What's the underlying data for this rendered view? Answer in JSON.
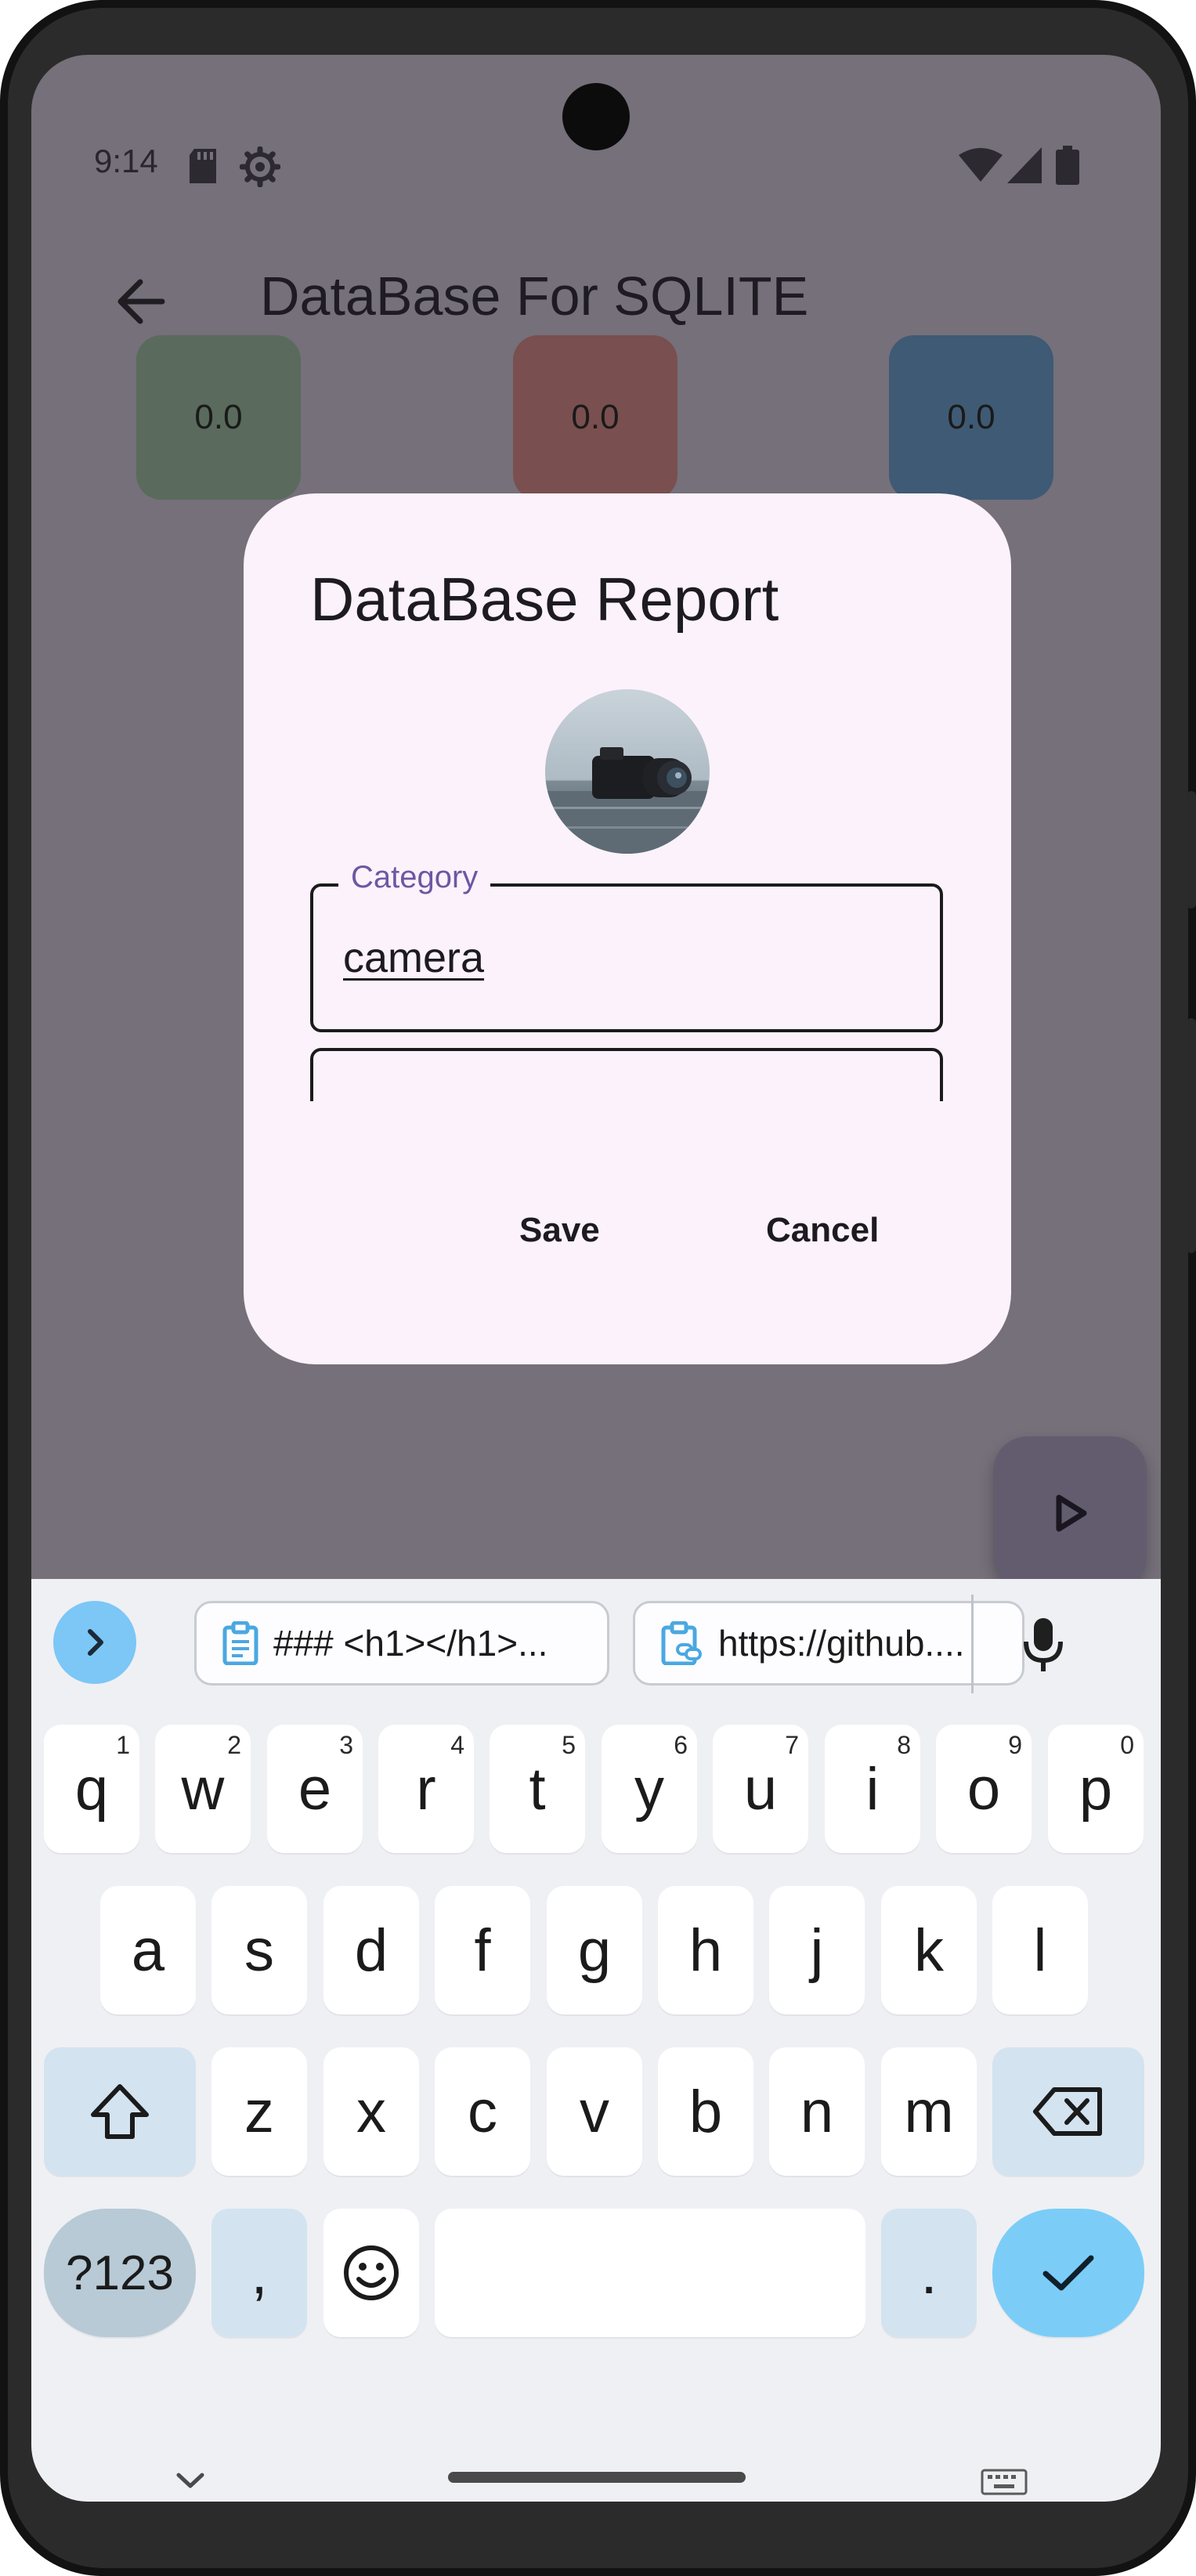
{
  "status_bar": {
    "time": "9:14",
    "left_icons": [
      "sd-card-icon",
      "settings-gear-icon"
    ],
    "right_icons": [
      "wifi-icon",
      "signal-icon",
      "battery-icon"
    ]
  },
  "app_bar": {
    "back_icon": "arrow-back-icon",
    "title": "DataBase For SQLITE"
  },
  "summary_tiles": [
    {
      "value": "0.0",
      "color": "#5a6a5c"
    },
    {
      "value": "0.0",
      "color": "#7a4f4f"
    },
    {
      "value": "0.0",
      "color": "#3f5a74"
    }
  ],
  "fab": {
    "icon": "play-arrow-icon"
  },
  "dialog": {
    "title": "DataBase Report",
    "image": "camera-photo",
    "category_label": "Category",
    "category_value": "camera",
    "save_label": "Save",
    "cancel_label": "Cancel"
  },
  "keyboard": {
    "expand_icon": "chevron-right-icon",
    "clipboard": [
      {
        "icon": "clipboard-icon",
        "text": "### <h1></h1>..."
      },
      {
        "icon": "clipboard-link-icon",
        "text": "https://github...."
      }
    ],
    "mic_icon": "mic-icon",
    "row1": [
      {
        "label": "q",
        "hint": "1"
      },
      {
        "label": "w",
        "hint": "2"
      },
      {
        "label": "e",
        "hint": "3"
      },
      {
        "label": "r",
        "hint": "4"
      },
      {
        "label": "t",
        "hint": "5"
      },
      {
        "label": "y",
        "hint": "6"
      },
      {
        "label": "u",
        "hint": "7"
      },
      {
        "label": "i",
        "hint": "8"
      },
      {
        "label": "o",
        "hint": "9"
      },
      {
        "label": "p",
        "hint": "0"
      }
    ],
    "row2": [
      "a",
      "s",
      "d",
      "f",
      "g",
      "h",
      "j",
      "k",
      "l"
    ],
    "row3": [
      "z",
      "x",
      "c",
      "v",
      "b",
      "n",
      "m"
    ],
    "shift_icon": "shift-icon",
    "backspace_icon": "backspace-icon",
    "symbols_label": "?123",
    "comma_label": ",",
    "emoji_icon": "emoji-icon",
    "period_label": ".",
    "enter_icon": "check-icon",
    "hide_keyboard_icon": "chevron-down-icon",
    "switch_keyboard_icon": "keyboard-icon"
  },
  "colors": {
    "scrim": "#75707a",
    "dialog_bg": "#fcf2fb",
    "accent_label": "#6e56a3",
    "keyboard_bg": "#eff0f4",
    "key_fn": "#d3e3f0",
    "enter_key": "#7bcdf7"
  }
}
